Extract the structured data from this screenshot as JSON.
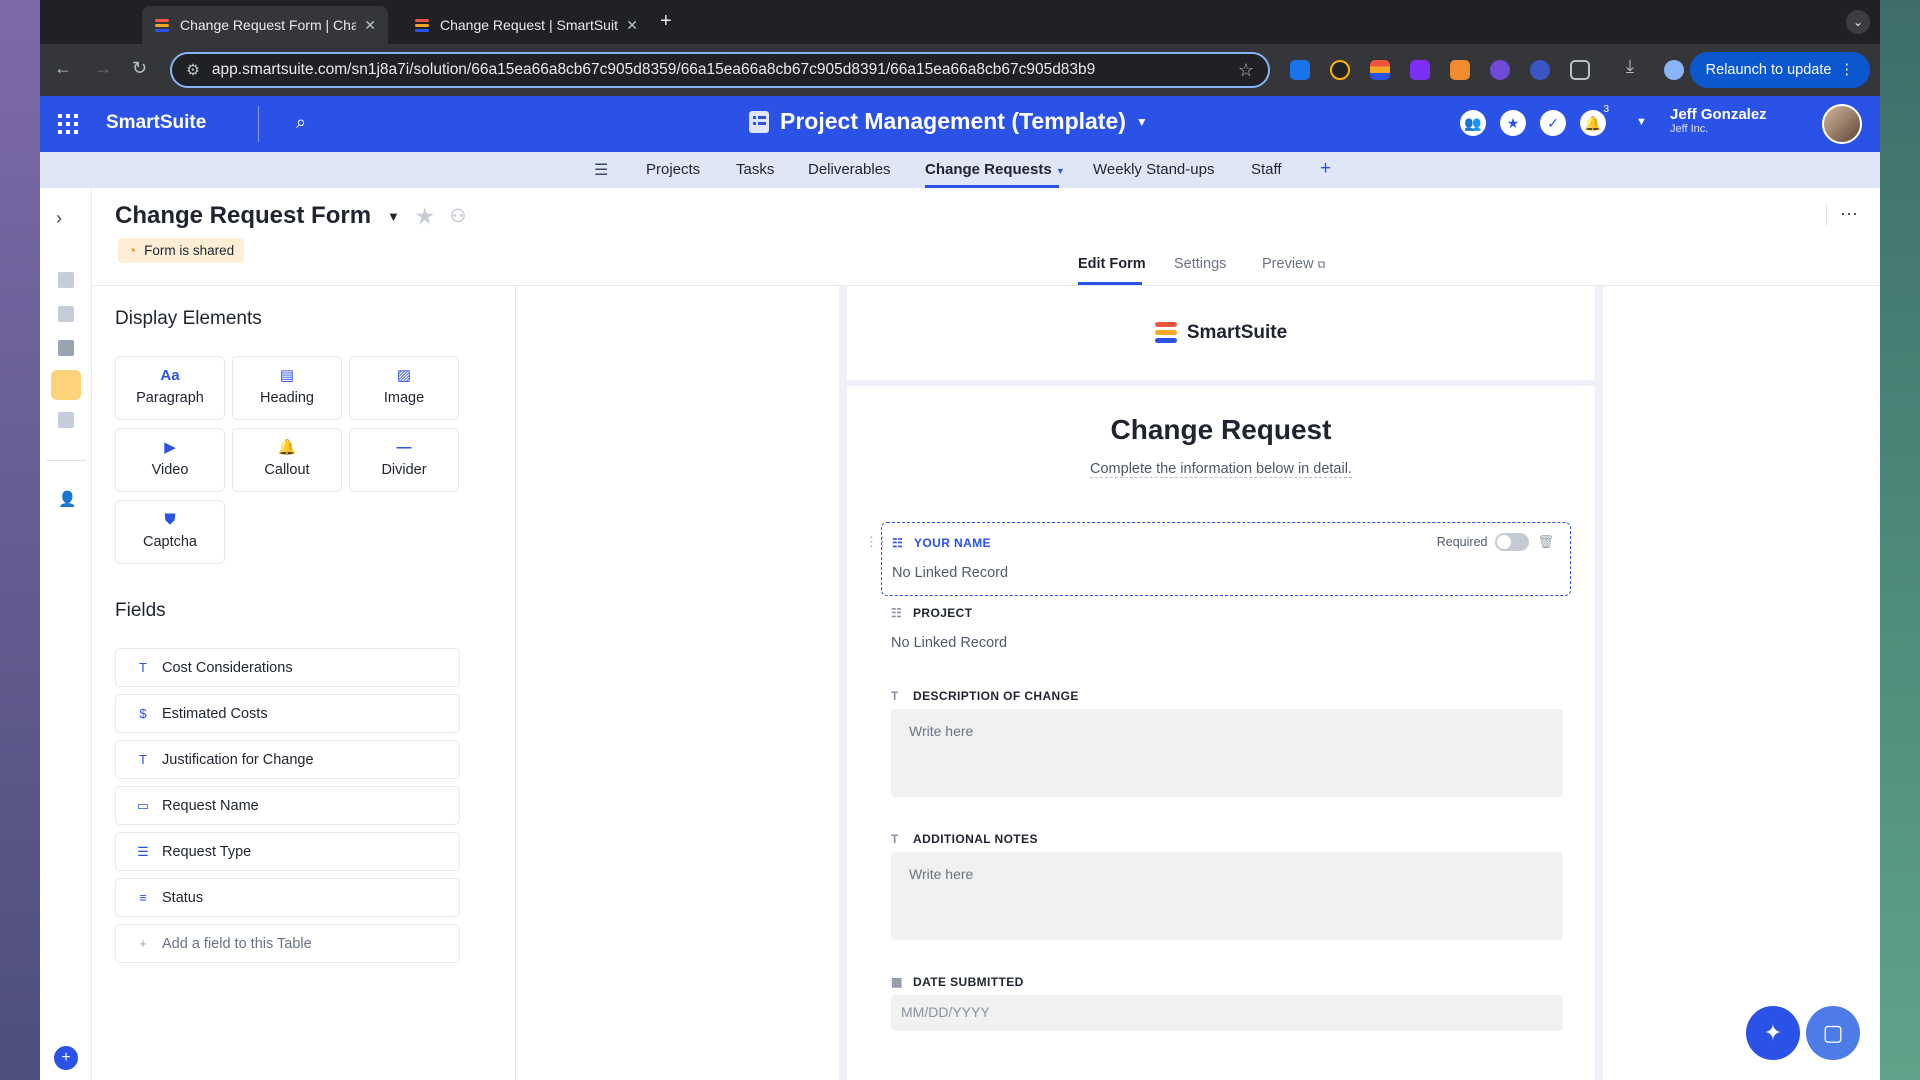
{
  "browser": {
    "tabs": [
      {
        "title": "Change Request Form | Chan"
      },
      {
        "title": "Change Request | SmartSuite"
      }
    ],
    "url": "app.smartsuite.com/sn1j8a7i/solution/66a15ea66a8cb67c905d8359/66a15ea66a8cb67c905d8391/66a15ea66a8cb67c905d83b9",
    "relaunch": "Relaunch to update"
  },
  "app": {
    "brand": "SmartSuite",
    "project": "Project Management (Template)",
    "notif_count": "3",
    "user_name": "Jeff Gonzalez",
    "user_company": "Jeff Inc."
  },
  "nav": {
    "tabs": [
      "Projects",
      "Tasks",
      "Deliverables",
      "Change Requests",
      "Weekly Stand-ups",
      "Staff"
    ],
    "active": "Change Requests"
  },
  "page": {
    "title": "Change Request Form",
    "shared_badge": "Form is shared",
    "form_tabs": [
      "Edit Form",
      "Settings",
      "Preview"
    ],
    "active_form_tab": "Edit Form"
  },
  "panel": {
    "display_title": "Display Elements",
    "elements": [
      {
        "label": "Paragraph",
        "icon": "paragraph-icon"
      },
      {
        "label": "Heading",
        "icon": "heading-icon"
      },
      {
        "label": "Image",
        "icon": "image-icon"
      },
      {
        "label": "Video",
        "icon": "video-icon"
      },
      {
        "label": "Callout",
        "icon": "bell-icon"
      },
      {
        "label": "Divider",
        "icon": "divider-icon"
      },
      {
        "label": "Captcha",
        "icon": "shield-icon"
      }
    ],
    "fields_title": "Fields",
    "fields": [
      {
        "label": "Cost Considerations",
        "icon": "text-field-icon"
      },
      {
        "label": "Estimated Costs",
        "icon": "dollar-icon"
      },
      {
        "label": "Justification for Change",
        "icon": "text-field-icon"
      },
      {
        "label": "Request Name",
        "icon": "record-title-icon"
      },
      {
        "label": "Request Type",
        "icon": "list-icon"
      },
      {
        "label": "Status",
        "icon": "status-icon"
      }
    ],
    "add_field": "Add a field to this Table"
  },
  "form": {
    "logo_text": "SmartSuite",
    "logo_colors": [
      "#f0543c",
      "#f5a623",
      "#2a52e6"
    ],
    "title": "Change Request",
    "subtitle": "Complete the information below in detail.",
    "questions": [
      {
        "label": "YOUR NAME",
        "value": "No Linked Record",
        "required_label": "Required",
        "required": false
      },
      {
        "label": "PROJECT",
        "value": "No Linked Record"
      },
      {
        "label": "DESCRIPTION OF CHANGE",
        "placeholder": "Write here"
      },
      {
        "label": "ADDITIONAL NOTES",
        "placeholder": "Write here"
      },
      {
        "label": "DATE SUBMITTED",
        "placeholder": "MM/DD/YYYY"
      }
    ]
  },
  "colors": {
    "accent": "#2a52e6",
    "shared_bg": "#fdeed5",
    "rss": "#ef8c1e"
  }
}
